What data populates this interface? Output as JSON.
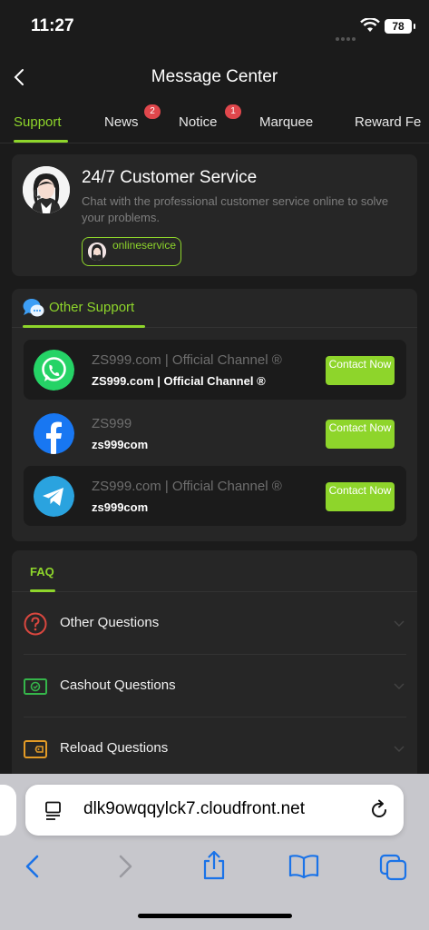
{
  "status_bar": {
    "time": "11:27",
    "battery": "78"
  },
  "header": {
    "title": "Message Center"
  },
  "tabs": [
    {
      "label": "Support",
      "active": true
    },
    {
      "label": "News",
      "badge": "2"
    },
    {
      "label": "Notice",
      "badge": "1"
    },
    {
      "label": "Marquee"
    },
    {
      "label": "Reward Fe"
    }
  ],
  "customer_service": {
    "title": "24/7 Customer Service",
    "description": "Chat with the professional customer service online to solve your problems.",
    "button_label": "onlineservice"
  },
  "other_support": {
    "title": "Other Support",
    "contacts": [
      {
        "icon": "whatsapp-icon",
        "name": "ZS999.com | Official Channel ®",
        "sub": "ZS999.com | Official Channel ®",
        "button": "Contact Now",
        "color": "#25D366"
      },
      {
        "icon": "facebook-icon",
        "name": "ZS999",
        "sub": "zs999com",
        "button": "Contact Now",
        "color": "#1877F2"
      },
      {
        "icon": "telegram-icon",
        "name": "ZS999.com | Official Channel ®",
        "sub": "zs999com",
        "button": "Contact Now",
        "color": "#2AA3DF"
      }
    ]
  },
  "faq": {
    "title": "FAQ",
    "items": [
      {
        "icon": "question-icon",
        "label": "Other Questions"
      },
      {
        "icon": "cashout-icon",
        "label": "Cashout Questions"
      },
      {
        "icon": "wallet-icon",
        "label": "Reload Questions"
      }
    ]
  },
  "browser": {
    "url": "dlk9owqqylck7.cloudfront.net"
  },
  "colors": {
    "accent": "#8ED52B",
    "background": "#1B1B1B",
    "card": "#262626",
    "badge": "#E0474C"
  }
}
